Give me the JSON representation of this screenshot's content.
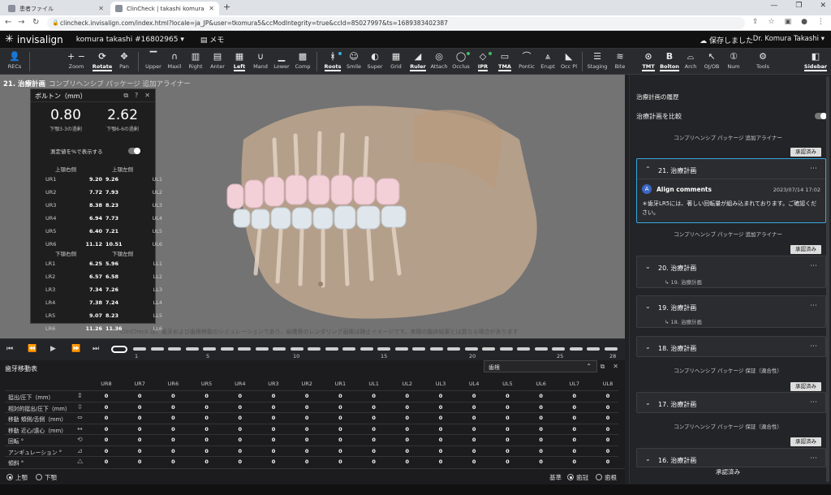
{
  "browser": {
    "tabs": [
      {
        "label": "患者ファイル"
      },
      {
        "label": "ClinCheck | takashi komura"
      }
    ],
    "url": "clincheck.invisalign.com/index.html?locale=ja_JP&user=tkomura5&ccModIntegrity=true&ccId=85027997&ts=1689383402387",
    "window_controls": {
      "minimize": "—",
      "restore": "❐",
      "close": "✕"
    }
  },
  "header": {
    "logo": "invisalign",
    "patient": "komura takashi #16802965",
    "memo": "メモ",
    "saved": "保存しました",
    "doctor": "Dr. Komura Takashi"
  },
  "toolbar": {
    "items": [
      {
        "label": "RECs",
        "icon": "person-icon"
      },
      {
        "label": "Zoom",
        "icon": "zoom-icon"
      },
      {
        "label": "Rotate",
        "icon": "rotate-icon"
      },
      {
        "label": "Pan",
        "icon": "pan-icon"
      },
      {
        "label": "Upper",
        "icon": "upper-icon"
      },
      {
        "label": "Maxil",
        "icon": "maxil-icon"
      },
      {
        "label": "Right",
        "icon": "right-icon"
      },
      {
        "label": "Anter",
        "icon": "anter-icon"
      },
      {
        "label": "Left",
        "icon": "left-icon"
      },
      {
        "label": "Mand",
        "icon": "mand-icon"
      },
      {
        "label": "Lower",
        "icon": "lower-icon"
      },
      {
        "label": "Comp",
        "icon": "comp-icon"
      },
      {
        "label": "Roots",
        "icon": "roots-icon"
      },
      {
        "label": "Smile",
        "icon": "smile-icon"
      },
      {
        "label": "Super",
        "icon": "super-icon"
      },
      {
        "label": "Grid",
        "icon": "grid-icon"
      },
      {
        "label": "Ruler",
        "icon": "ruler-icon"
      },
      {
        "label": "Attach",
        "icon": "attach-icon"
      },
      {
        "label": "Occlus",
        "icon": "occlus-icon"
      },
      {
        "label": "IPR",
        "icon": "ipr-icon"
      },
      {
        "label": "TMA",
        "icon": "tma-icon"
      },
      {
        "label": "Pontic",
        "icon": "pontic-icon"
      },
      {
        "label": "Erupt",
        "icon": "erupt-icon"
      },
      {
        "label": "Occ Pl",
        "icon": "occpl-icon"
      },
      {
        "label": "Staging",
        "icon": "staging-icon"
      },
      {
        "label": "Bite",
        "icon": "bite-icon"
      },
      {
        "label": "TMT",
        "icon": "tmt-icon"
      },
      {
        "label": "Bolton",
        "icon": "bolton-icon"
      },
      {
        "label": "Arch",
        "icon": "arch-icon"
      },
      {
        "label": "OJ/OB",
        "icon": "ojob-icon"
      },
      {
        "label": "Num",
        "icon": "num-icon"
      },
      {
        "label": "Tools",
        "icon": "tools-icon"
      },
      {
        "label": "Sidebar",
        "icon": "sidebar-icon"
      }
    ]
  },
  "viewport": {
    "plan_title": "21. 治療計画",
    "plan_sub": "コンプリヘンシブ パッケージ 追加アライナー",
    "disclaimer": "ClinCheck は、歯牙および歯根移動のシミュレーションであり、歯槽骨のレンダリング画像は静止イメージです。実際の臨床結果とは異なる場合があります"
  },
  "bolton": {
    "title": "ボルトン（mm）",
    "upper_ratio": "0.80",
    "upper_ratio_label": "下顎3-3の過剰",
    "lower_ratio": "2.62",
    "lower_ratio_label": "下顎6-6の過剰",
    "toggle_label": "測定値を%で表示する",
    "upper_right_title": "上顎右側",
    "upper_left_title": "上顎左側",
    "lower_right_title": "下顎右側",
    "lower_left_title": "下顎左側",
    "upper_right": [
      [
        "UR1",
        "9.20"
      ],
      [
        "UR2",
        "7.72"
      ],
      [
        "UR3",
        "8.38"
      ],
      [
        "UR4",
        "6.94"
      ],
      [
        "UR5",
        "6.40"
      ],
      [
        "UR6",
        "11.12"
      ]
    ],
    "upper_left": [
      [
        "9.26",
        "UL1"
      ],
      [
        "7.93",
        "UL2"
      ],
      [
        "8.23",
        "UL3"
      ],
      [
        "7.73",
        "UL4"
      ],
      [
        "7.21",
        "UL5"
      ],
      [
        "10.51",
        "UL6"
      ]
    ],
    "lower_right": [
      [
        "LR1",
        "6.25"
      ],
      [
        "LR2",
        "6.57"
      ],
      [
        "LR3",
        "7.34"
      ],
      [
        "LR4",
        "7.38"
      ],
      [
        "LR5",
        "9.07"
      ],
      [
        "LR6",
        "11.26"
      ]
    ],
    "lower_left": [
      [
        "5.96",
        "LL1"
      ],
      [
        "6.58",
        "LL2"
      ],
      [
        "7.26",
        "LL3"
      ],
      [
        "7.24",
        "LL4"
      ],
      [
        "8.23",
        "LL5"
      ],
      [
        "11.36",
        "LL6"
      ]
    ]
  },
  "timeline": {
    "labels": [
      "1",
      "5",
      "10",
      "15",
      "20",
      "25",
      "28"
    ],
    "controls": [
      "⏮",
      "⏪",
      "▶",
      "⏩",
      "⏭"
    ]
  },
  "tooth_movement": {
    "title": "歯牙移動表",
    "root_selector": "歯根",
    "columns": [
      "UR8",
      "UR7",
      "UR6",
      "UR5",
      "UR4",
      "UR3",
      "UR2",
      "UR1",
      "UL1",
      "UL2",
      "UL3",
      "UL4",
      "UL5",
      "UL6",
      "UL7",
      "UL8"
    ],
    "rows": [
      {
        "label": "挺出/圧下（mm）",
        "icon": "extrusion-icon"
      },
      {
        "label": "相対的挺出/圧下（mm）",
        "icon": "relative-extrusion-icon"
      },
      {
        "label": "移動 頬側/舌側（mm）",
        "icon": "buccal-lingual-icon"
      },
      {
        "label": "移動 近心/遠心（mm）",
        "icon": "mesial-distal-icon"
      },
      {
        "label": "回転 °",
        "icon": "rotation-icon"
      },
      {
        "label": "アンギュレーション °",
        "icon": "angulation-icon"
      },
      {
        "label": "傾斜 °",
        "icon": "inclination-icon"
      }
    ],
    "value": "0"
  },
  "bottombar": {
    "upper": "上顎",
    "lower": "下顎",
    "base_label": "基準",
    "crown": "歯冠",
    "root": "歯根"
  },
  "sidebar": {
    "header": "治療計画の履歴",
    "compare": "治療計画を比較",
    "approved": "承認済み",
    "pkg_extra": "コンプリヘンシブ パッケージ 追加アライナー",
    "pkg_warranty": "コンプリヘンシブ パッケージ 保証（適合性）",
    "plans": [
      {
        "title": "21. 治療計画"
      },
      {
        "title": "20. 治療計画",
        "sub": "19. 治療計画"
      },
      {
        "title": "19. 治療計画",
        "sub": "18. 治療計画"
      },
      {
        "title": "18. 治療計画"
      },
      {
        "title": "17. 治療計画"
      },
      {
        "title": "16. 治療計画"
      }
    ],
    "comment_author": "Align comments",
    "comment_date": "2023/07/14 17:02",
    "comment_text": "＊歯牙LR5には、著しい回転量が組み込まれております。ご確認ください。",
    "footer": "承認済み"
  },
  "colors": {
    "accent": "#39a6e0",
    "status_green": "#3cc060"
  }
}
